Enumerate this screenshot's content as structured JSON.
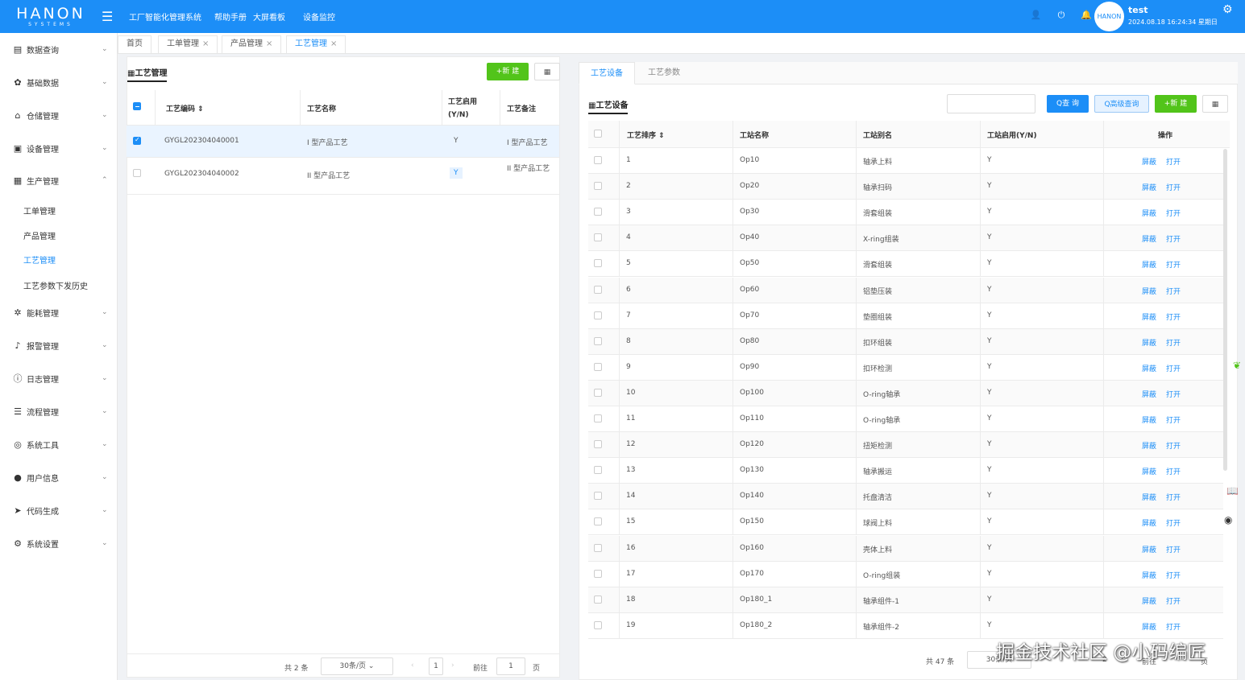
{
  "header": {
    "logo_main": "HANON",
    "logo_sub": "SYSTEMS",
    "nav": [
      "工厂智能化管理系统",
      "帮助手册",
      "大屏看板",
      "设备监控"
    ],
    "avatar_text": "HANON",
    "user_name": "test",
    "user_time": "2024.08.18 16:24:34 星期日"
  },
  "sidebar": {
    "items": [
      {
        "label": "数据查询",
        "icon": "document-icon"
      },
      {
        "label": "基础数据",
        "icon": "gear-icon"
      },
      {
        "label": "仓储管理",
        "icon": "home-icon"
      },
      {
        "label": "设备管理",
        "icon": "chart-icon"
      },
      {
        "label": "生产管理",
        "icon": "grid-icon"
      },
      {
        "label": "能耗管理",
        "icon": "cog-icon"
      },
      {
        "label": "报警管理",
        "icon": "bell-icon"
      },
      {
        "label": "日志管理",
        "icon": "info-icon"
      },
      {
        "label": "流程管理",
        "icon": "sliders-icon"
      },
      {
        "label": "系统工具",
        "icon": "tools-icon"
      },
      {
        "label": "用户信息",
        "icon": "user-icon"
      },
      {
        "label": "代码生成",
        "icon": "send-icon"
      },
      {
        "label": "系统设置",
        "icon": "settings-icon"
      }
    ],
    "sub_items": [
      "工单管理",
      "产品管理",
      "工艺管理",
      "工艺参数下发历史"
    ]
  },
  "tabs": [
    "首页",
    "工单管理",
    "产品管理",
    "工艺管理"
  ],
  "left_panel": {
    "title": "工艺管理",
    "add_label": "+新 建",
    "headers": [
      "工艺编码",
      "工艺名称",
      "工艺启用(Y/N)",
      "工艺备注"
    ],
    "rows": [
      {
        "code": "GYGL202304040001",
        "name": "I 型产品工艺",
        "enabled": "Y",
        "remark": "I 型产品工艺"
      },
      {
        "code": "GYGL202304040002",
        "name": "II 型产品工艺",
        "enabled": "Y",
        "remark": "II 型产品工艺"
      }
    ],
    "pager": {
      "total": "共 2 条",
      "page_size": "30条/页",
      "page": "1",
      "goto": "前往",
      "goto_value": "1",
      "page_unit": "页"
    }
  },
  "right_panel": {
    "tabs": [
      "工艺设备",
      "工艺参数"
    ],
    "title": "工艺设备",
    "query_label": "Q查 询",
    "advanced_label": "Q高级查询",
    "add_label": "+新 建",
    "headers": [
      "工艺排序",
      "工站名称",
      "工站别名",
      "工站启用(Y/N)",
      "操作"
    ],
    "action_block": "屏蔽",
    "action_open": "打开",
    "rows": [
      {
        "seq": "1",
        "name": "Op10",
        "alias": "轴承上料",
        "enabled": "Y"
      },
      {
        "seq": "2",
        "name": "Op20",
        "alias": "轴承扫码",
        "enabled": "Y"
      },
      {
        "seq": "3",
        "name": "Op30",
        "alias": "滑套组装",
        "enabled": "Y"
      },
      {
        "seq": "4",
        "name": "Op40",
        "alias": "X-ring组装",
        "enabled": "Y"
      },
      {
        "seq": "5",
        "name": "Op50",
        "alias": "滑套组装",
        "enabled": "Y"
      },
      {
        "seq": "6",
        "name": "Op60",
        "alias": "铝垫压装",
        "enabled": "Y"
      },
      {
        "seq": "7",
        "name": "Op70",
        "alias": "垫圈组装",
        "enabled": "Y"
      },
      {
        "seq": "8",
        "name": "Op80",
        "alias": "扣环组装",
        "enabled": "Y"
      },
      {
        "seq": "9",
        "name": "Op90",
        "alias": "扣环检测",
        "enabled": "Y"
      },
      {
        "seq": "10",
        "name": "Op100",
        "alias": "O-ring轴承",
        "enabled": "Y"
      },
      {
        "seq": "11",
        "name": "Op110",
        "alias": "O-ring轴承",
        "enabled": "Y"
      },
      {
        "seq": "12",
        "name": "Op120",
        "alias": "扭矩检测",
        "enabled": "Y"
      },
      {
        "seq": "13",
        "name": "Op130",
        "alias": "轴承搬运",
        "enabled": "Y"
      },
      {
        "seq": "14",
        "name": "Op140",
        "alias": "托盘清洁",
        "enabled": "Y"
      },
      {
        "seq": "15",
        "name": "Op150",
        "alias": "球阀上料",
        "enabled": "Y"
      },
      {
        "seq": "16",
        "name": "Op160",
        "alias": "壳体上料",
        "enabled": "Y"
      },
      {
        "seq": "17",
        "name": "Op170",
        "alias": "O-ring组装",
        "enabled": "Y"
      },
      {
        "seq": "18",
        "name": "Op180_1",
        "alias": "轴承组件-1",
        "enabled": "Y"
      },
      {
        "seq": "19",
        "name": "Op180_2",
        "alias": "轴承组件-2",
        "enabled": "Y"
      }
    ],
    "pager": {
      "total": "共 47 条",
      "page_size": "30条/页",
      "page2": "2",
      "goto": "前往",
      "page_unit": "页"
    }
  },
  "watermark": "掘金技术社区 @小码编匠"
}
